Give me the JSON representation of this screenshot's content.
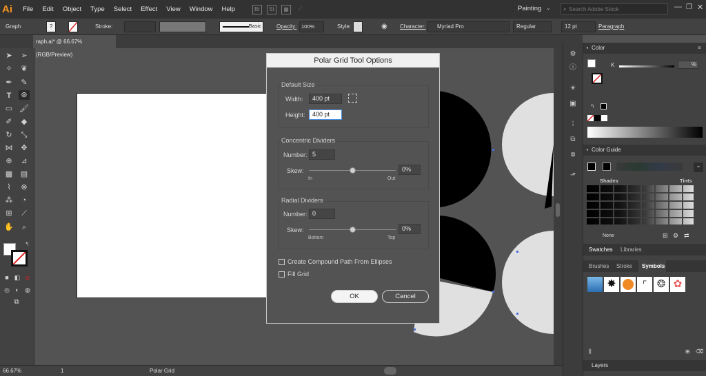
{
  "app": {
    "logo": "Ai"
  },
  "menu": [
    "File",
    "Edit",
    "Object",
    "Type",
    "Select",
    "Effect",
    "View",
    "Window",
    "Help"
  ],
  "menubar_icons": {
    "bridge": "Br",
    "stock": "St"
  },
  "workspace": {
    "label": "Painting",
    "search_placeholder": "Search Adobe Stock"
  },
  "control_bar": {
    "selection_label": "Graph",
    "stroke_label": "Stroke:",
    "brush_label": "Basic",
    "opacity_label": "Opacity:",
    "opacity_value": "100%",
    "style_label": "Style:",
    "character_label": "Character:",
    "font_name": "Myriad Pro",
    "font_style": "Regular",
    "font_size": "12 pt",
    "paragraph_label": "Paragraph"
  },
  "document_tab": {
    "title": "raph.ai* @ 66.67% (RGB/Preview)"
  },
  "status_bar": {
    "zoom": "66.67%",
    "page": "1",
    "tool_name": "Polar Grid"
  },
  "dialog": {
    "title": "Polar Grid Tool Options",
    "default_size": {
      "label": "Default Size",
      "width_label": "Width:",
      "width_value": "400 pt",
      "height_label": "Height:",
      "height_value": "400 pt"
    },
    "concentric": {
      "label": "Concentric Dividers",
      "number_label": "Number:",
      "number_value": "5",
      "skew_label": "Skew:",
      "skew_value": "0%",
      "skew_position": 0.5,
      "left_tick": "In",
      "right_tick": "Out"
    },
    "radial": {
      "label": "Radial Dividers",
      "number_label": "Number:",
      "number_value": "0",
      "skew_label": "Skew:",
      "skew_value": "0%",
      "skew_position": 0.5,
      "left_tick": "Bottom",
      "right_tick": "Top"
    },
    "compound_path": {
      "label": "Create Compound Path From Ellipses",
      "checked": false
    },
    "fill_grid": {
      "label": "Fill Grid",
      "checked": false
    },
    "ok_label": "OK",
    "cancel_label": "Cancel"
  },
  "panels": {
    "color": {
      "title": "Color",
      "channel_label": "K",
      "value": "%"
    },
    "color_guide": {
      "title": "Color Guide",
      "shades_label": "Shades",
      "tints_label": "Tints",
      "none_label": "None"
    },
    "swatches_tabs": [
      "Swatches",
      "Libraries"
    ],
    "brushes_tabs": [
      "Brushes",
      "Stroke",
      "Symbols"
    ],
    "layers": {
      "title": "Layers"
    }
  },
  "colors": {
    "accent": "#f7941d",
    "selection_blue": "#4a6fd6",
    "black": "#000000",
    "light_gray": "#e0e0e0"
  }
}
